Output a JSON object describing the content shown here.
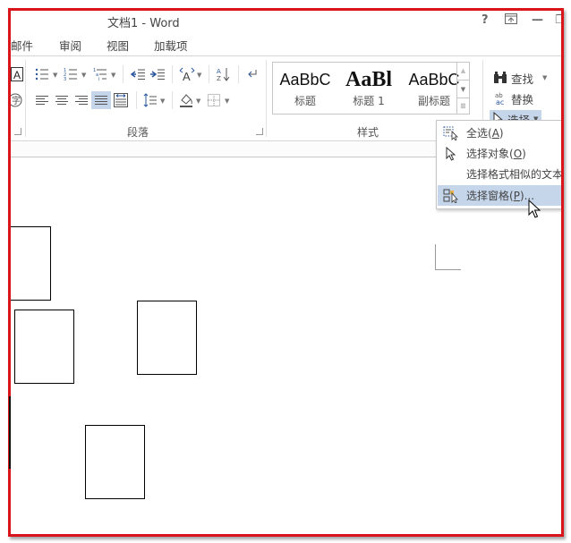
{
  "window": {
    "title": "文档1 - Word",
    "controls": {
      "help": "?",
      "ribbon_display": "⊼",
      "minimize": "—",
      "restore": "❐"
    }
  },
  "tabs": [
    {
      "label": "邮件"
    },
    {
      "label": "审阅"
    },
    {
      "label": "视图"
    },
    {
      "label": "加载项"
    }
  ],
  "ribbon": {
    "paragraph": {
      "label": "段落",
      "icons": [
        "bullets-icon",
        "numbering-icon",
        "multilevel-list-icon",
        "decrease-indent-icon",
        "increase-indent-icon",
        "chinese-layout-icon",
        "sort-icon",
        "show-formatting-icon",
        "align-left-icon",
        "center-icon",
        "align-right-icon",
        "justify-icon",
        "distributed-icon",
        "line-spacing-icon",
        "shading-icon",
        "borders-icon"
      ]
    },
    "styles": {
      "label": "样式",
      "items": [
        {
          "sample": "AaBbC",
          "name": "标题"
        },
        {
          "sample": "AaBl",
          "name": "标题 1"
        },
        {
          "sample": "AaBbC",
          "name": "副标题"
        }
      ]
    },
    "editing": {
      "find": "查找",
      "replace": "替换",
      "select": "选择"
    }
  },
  "select_menu": {
    "items": [
      {
        "label": "全选",
        "key": "A",
        "icon": "select-all-icon"
      },
      {
        "label": "选择对象",
        "key": "O",
        "icon": "select-objects-icon"
      },
      {
        "label": "选择格式相似的文本",
        "key": "",
        "icon": ""
      },
      {
        "label": "选择窗格",
        "key": "P",
        "suffix": "...",
        "icon": "selection-pane-icon",
        "highlighted": true
      }
    ]
  },
  "colors": {
    "highlight": "#c5d5ea",
    "frame": "#d9141b"
  }
}
